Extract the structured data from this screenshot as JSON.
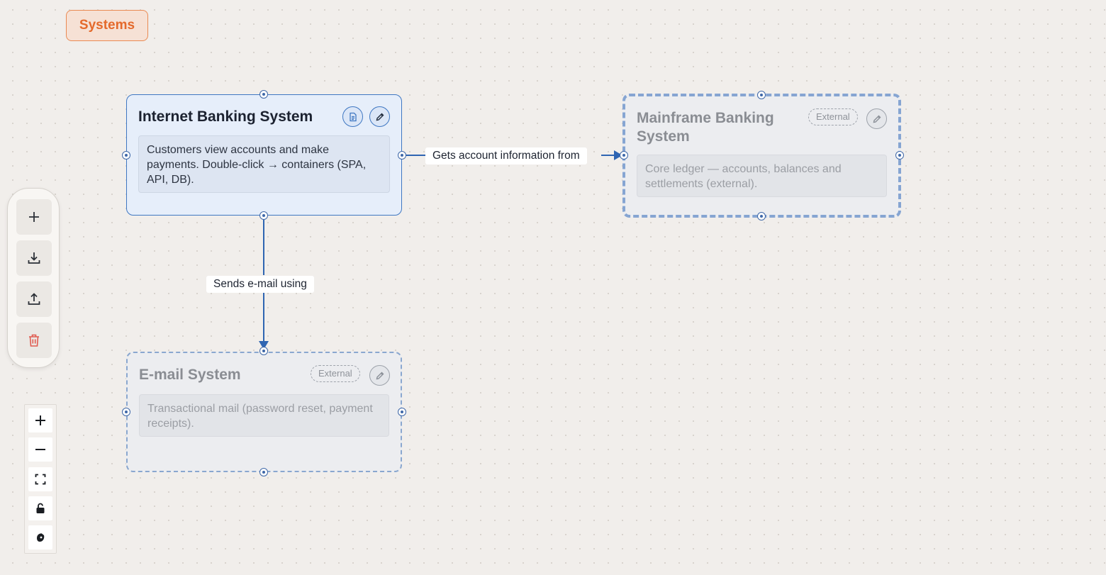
{
  "breadcrumb": {
    "label": "Systems"
  },
  "nodes": [
    {
      "id": "internet-banking",
      "title": "Internet Banking System",
      "description": "Customers view accounts and make payments. Double-click → containers (SPA, API, DB).",
      "external": false
    },
    {
      "id": "mainframe-banking",
      "title": "Mainframe Banking System",
      "description": "Core ledger — accounts, balances and settlements (external).",
      "badge": "External",
      "external": true
    },
    {
      "id": "email-system",
      "title": "E-mail System",
      "description": "Transactional mail (password reset, payment receipts).",
      "badge": "External",
      "external": true
    }
  ],
  "edges": [
    {
      "from": "internet-banking",
      "to": "mainframe-banking",
      "label": "Gets account information from"
    },
    {
      "from": "internet-banking",
      "to": "email-system",
      "label": "Sends e-mail using"
    }
  ],
  "toolbar": {
    "items": [
      {
        "name": "add-node-button",
        "icon": "plus-icon"
      },
      {
        "name": "import-button",
        "icon": "download-icon"
      },
      {
        "name": "export-button",
        "icon": "upload-icon"
      },
      {
        "name": "delete-button",
        "icon": "trash-icon"
      }
    ]
  },
  "zoom_controls": {
    "items": [
      {
        "name": "zoom-in-button",
        "icon": "plus-icon"
      },
      {
        "name": "zoom-out-button",
        "icon": "minus-icon"
      },
      {
        "name": "fit-view-button",
        "icon": "fit-view-icon"
      },
      {
        "name": "lock-toggle-button",
        "icon": "unlock-icon"
      },
      {
        "name": "minimap-button",
        "icon": "minimap-icon"
      }
    ]
  },
  "colors": {
    "accent": "#3f77c2",
    "external_border": "#8aa7cf",
    "breadcrumb": "#e4692b",
    "danger": "#e05a4f"
  }
}
